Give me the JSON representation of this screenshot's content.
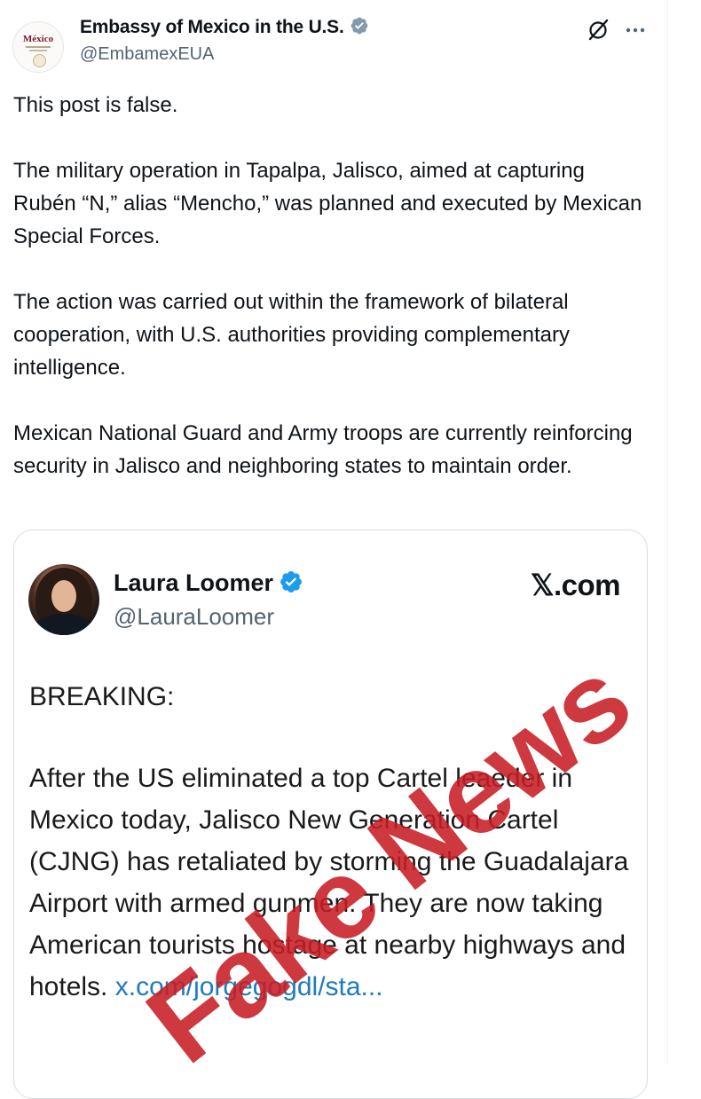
{
  "post": {
    "author_name": "Embassy of Mexico in the U.S.",
    "author_handle": "@EmbamexEUA",
    "avatar_text": "México",
    "paragraphs": [
      "This post is false.",
      "The military operation in Tapalpa, Jalisco, aimed at capturing Rubén “N,” alias “Mencho,” was planned and executed by Mexican Special Forces.",
      "The action was carried out within the framework of bilateral cooperation, with U.S. authorities providing complementary intelligence.",
      "Mexican National Guard and Army troops are currently reinforcing security in Jalisco and neighboring states to maintain order."
    ]
  },
  "quoted": {
    "author_name": "Laura Loomer",
    "author_handle": "@LauraLoomer",
    "site": "𝕏.com",
    "heading": "BREAKING:",
    "body": "After the US eliminated a top Cartel leaeder in Mexico today, Jalisco New Generation Cartel (CJNG) has retaliated by storming the Guadalajara Airport with armed gunmen. They are now taking American tourists hostage at nearby highways and hotels. ",
    "link": "x.com/jorgegogdl/sta...",
    "stamp": "Fake News"
  },
  "colors": {
    "verified_badge": "#829aab",
    "quoted_verified_badge": "#1d9bf0",
    "link": "#1d7bbf",
    "stamp": "#c81d25"
  },
  "icons": [
    "verified-badge-icon",
    "grok-icon",
    "more-icon"
  ]
}
